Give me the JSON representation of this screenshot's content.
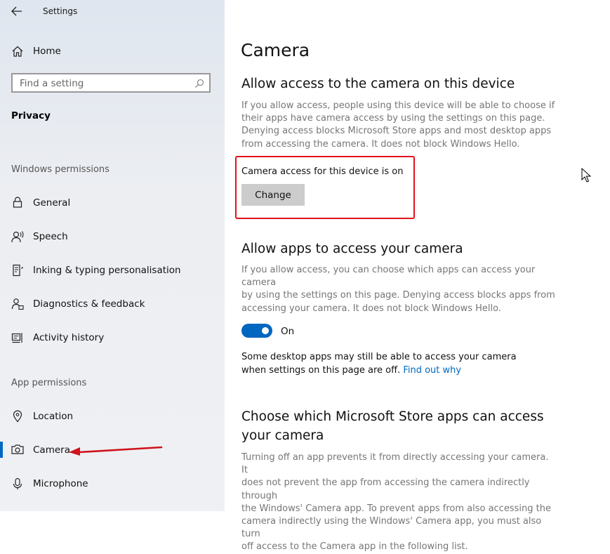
{
  "window": {
    "title": "Settings"
  },
  "sidebar": {
    "home_label": "Home",
    "search_placeholder": "Find a setting",
    "category": "Privacy",
    "windows_permissions_header": "Windows permissions",
    "windows_items": [
      {
        "label": "General",
        "icon": "lock-icon"
      },
      {
        "label": "Speech",
        "icon": "speech-icon"
      },
      {
        "label": "Inking & typing personalisation",
        "icon": "inking-icon"
      },
      {
        "label": "Diagnostics & feedback",
        "icon": "diagnostics-icon"
      },
      {
        "label": "Activity history",
        "icon": "activity-history-icon"
      }
    ],
    "app_permissions_header": "App permissions",
    "app_items": [
      {
        "label": "Location",
        "icon": "location-icon"
      },
      {
        "label": "Camera",
        "icon": "camera-icon",
        "selected": true
      },
      {
        "label": "Microphone",
        "icon": "microphone-icon"
      }
    ]
  },
  "main": {
    "title": "Camera",
    "device_section": {
      "heading": "Allow access to the camera on this device",
      "description": "If you allow access, people using this device will be able to choose if\ntheir apps have camera access by using the settings on this page.\nDenying access blocks Microsoft Store apps and most desktop apps\nfrom accessing the camera. It does not block Windows Hello.",
      "status": "Camera access for this device is on",
      "change_label": "Change"
    },
    "apps_section": {
      "heading": "Allow apps to access your camera",
      "description": "If you allow access, you can choose which apps can access your camera\nby using the settings on this page. Denying access blocks apps from\naccessing your camera. It does not block Windows Hello.",
      "toggle_state": "On",
      "note_text": "Some desktop apps may still be able to access your camera when settings on this page are off. ",
      "note_link": "Find out why"
    },
    "store_section": {
      "heading_line1": "Choose which Microsoft Store apps can access",
      "heading_line2": "your camera",
      "description": "Turning off an app prevents it from directly accessing your camera. It\ndoes not prevent the app from accessing the camera indirectly through\nthe Windows' Camera app. To prevent apps from also accessing the\ncamera indirectly using the Windows' Camera app, you must also turn\noff access to the Camera app in the following list."
    }
  },
  "colors": {
    "accent": "#0067c0",
    "highlight_box": "#e2121c",
    "annotation_arrow": "#d0121b"
  }
}
